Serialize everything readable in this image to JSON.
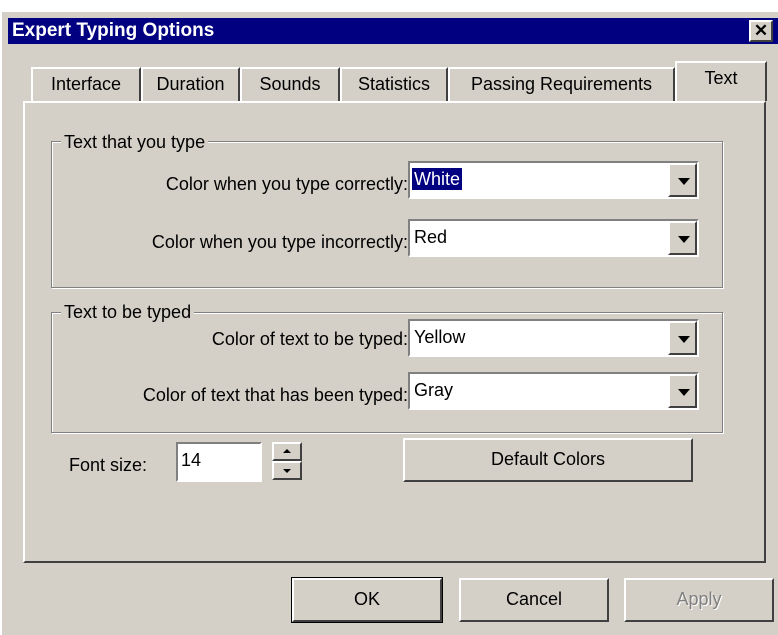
{
  "window": {
    "title": "Expert Typing Options",
    "close_symbol": "✕",
    "close_icon": "close-icon"
  },
  "tabs": [
    {
      "label": "Interface",
      "active": false
    },
    {
      "label": "Duration",
      "active": false
    },
    {
      "label": "Sounds",
      "active": false
    },
    {
      "label": "Statistics",
      "active": false
    },
    {
      "label": "Passing Requirements",
      "active": false
    },
    {
      "label": "Text",
      "active": true
    }
  ],
  "group_typed": {
    "label": "Text that you type",
    "correct_label": "Color when you type correctly:",
    "correct_value": "White",
    "incorrect_label": "Color when you type incorrectly:",
    "incorrect_value": "Red"
  },
  "group_to_type": {
    "label": "Text to be typed",
    "to_type_label": "Color of text to be typed:",
    "to_type_value": "Yellow",
    "typed_label": "Color of text that has been typed:",
    "typed_value": "Gray"
  },
  "font_size": {
    "label": "Font size:",
    "value": "14"
  },
  "buttons": {
    "default_colors": "Default Colors",
    "ok": "OK",
    "cancel": "Cancel",
    "apply": "Apply"
  },
  "colors": {
    "title_bar": "#000080",
    "face": "#d4d0c8",
    "selection": "#000080"
  }
}
